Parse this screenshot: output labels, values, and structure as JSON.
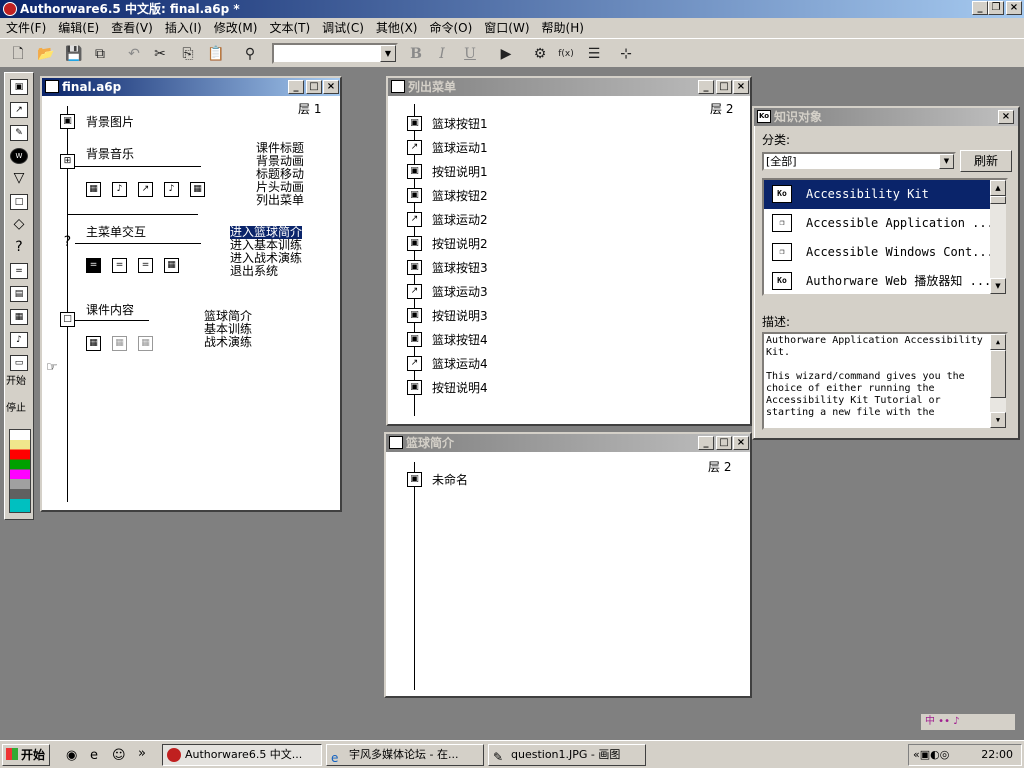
{
  "app": {
    "title": "Authorware6.5 中文版: final.a6p *"
  },
  "menu": [
    "文件(F)",
    "编辑(E)",
    "查看(V)",
    "插入(I)",
    "修改(M)",
    "文本(T)",
    "调试(C)",
    "其他(X)",
    "命令(O)",
    "窗口(W)",
    "帮助(H)"
  ],
  "toolbar": {
    "icons": [
      "new-file-icon",
      "open-icon",
      "save-all-icon",
      "import-icon",
      "undo-icon",
      "cut-icon",
      "copy-icon",
      "paste-icon",
      "find-icon",
      "bold-icon",
      "italic-icon",
      "underline-icon",
      "run-icon",
      "control-panel-icon",
      "functions-icon",
      "variables-icon",
      "knowledge-objects-icon"
    ],
    "bold": "B",
    "italic": "I",
    "underline": "U"
  },
  "palette": {
    "start": "开始",
    "stop": "停止",
    "icons": [
      "display",
      "motion",
      "erase",
      "wait",
      "navigate",
      "framework",
      "decision",
      "interaction",
      "calculation",
      "map",
      "digital-movie",
      "sound",
      "video"
    ]
  },
  "main_window": {
    "title": "final.a6p",
    "layer": "层 1",
    "items": {
      "bg_image": "背景图片",
      "bg_music": "背景音乐",
      "main_menu": "主菜单交互",
      "content": "课件内容"
    },
    "group1": [
      "课件标题",
      "背景动画",
      "标题移动",
      "片头动画",
      "列出菜单"
    ],
    "group2": [
      "进入篮球简介",
      "进入基本训练",
      "进入战术演练",
      "退出系统"
    ],
    "group3": [
      "篮球简介",
      "基本训练",
      "战术演练"
    ]
  },
  "list_window": {
    "title": "列出菜单",
    "layer": "层 2",
    "items": [
      "篮球按钮1",
      "篮球运动1",
      "按钮说明1",
      "篮球按钮2",
      "篮球运动2",
      "按钮说明2",
      "篮球按钮3",
      "篮球运动3",
      "按钮说明3",
      "篮球按钮4",
      "篮球运动4",
      "按钮说明4"
    ]
  },
  "intro_window": {
    "title": "篮球简介",
    "layer": "层 2",
    "item": "未命名"
  },
  "knowledge": {
    "title": "知识对象",
    "category_label": "分类:",
    "category_value": "[全部]",
    "refresh": "刷新",
    "items": [
      "Accessibility Kit",
      "Accessible Application ...",
      "Accessible Windows Cont...",
      "Authorware Web 播放器知 ..."
    ],
    "desc_label": "描述:",
    "desc": "Authorware Application Accessibility Kit.\n\nThis wizard/command gives you the choice of either running the Accessibility Kit Tutorial or starting a new file with the"
  },
  "taskbar": {
    "start": "开始",
    "tasks": [
      "Authorware6.5 中文...",
      "宇风多媒体论坛 - 在...",
      "question1.JPG - 画图"
    ],
    "clock": "22:00",
    "chevron": "»"
  },
  "tray_small": "中 •• ♪"
}
